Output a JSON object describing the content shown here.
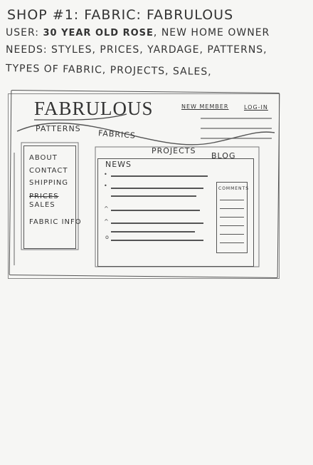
{
  "heading": "SHOP #1: FABRIC: FABRULOUS",
  "user_label": "USER:",
  "user_value_bold": "30 YEAR OLD ROSE",
  "user_value_rest": ", NEW HOME OWNER",
  "needs_line": "NEEDS: STYLES, PRICES, YARDAGE, PATTERNS,",
  "types_line": "TYPES OF FABRIC, PROJECTS, SALES,",
  "wireframe": {
    "logo": "FABRULOUS",
    "new_member": "NEW MEMBER",
    "log_in": "LOG-IN",
    "nav": [
      "PATTERNS",
      "FABRICS",
      "PROJECTS",
      "BLOG"
    ],
    "sidebar": [
      "ABOUT",
      "CONTACT",
      "SHIPPING",
      "PRICES",
      "SALES",
      "FABRIC INFO"
    ],
    "news_title": "NEWS",
    "comments_title": "COMMENTS"
  }
}
